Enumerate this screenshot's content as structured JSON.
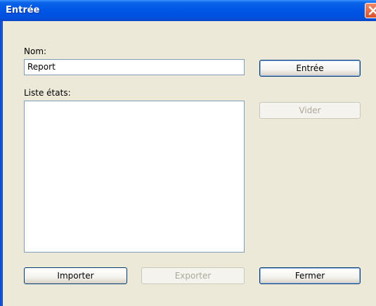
{
  "window": {
    "title": "Entrée"
  },
  "form": {
    "nom_label": "Nom:",
    "nom_value": "Report",
    "liste_label": "Liste états:",
    "liste_items": []
  },
  "buttons": {
    "entree": "Entrée",
    "vider": "Vider",
    "importer": "Importer",
    "exporter": "Exporter",
    "fermer": "Fermer"
  },
  "colors": {
    "title_bar": "#0055e5",
    "close_button": "#d9532b",
    "dialog_background": "#ece9d8"
  },
  "icons": {
    "close": "close-x-icon"
  }
}
